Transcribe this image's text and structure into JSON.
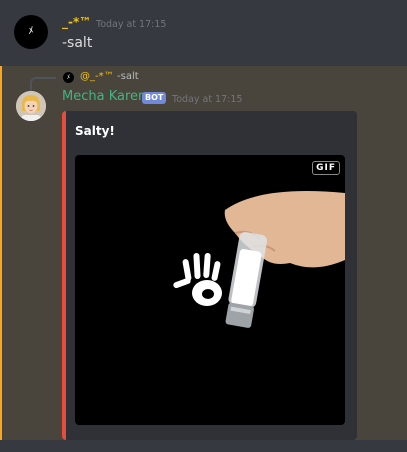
{
  "message1": {
    "author": "_-*™",
    "timestamp": "Today at 17:15",
    "content": "-salt"
  },
  "message2": {
    "reply": {
      "author": "@_-*™",
      "content": "-salt"
    },
    "author": "Mecha Karen",
    "badge": "BOT",
    "timestamp": "Today at 17:15",
    "embed": {
      "title": "Salty!",
      "gif_label": "GIF",
      "accent_color": "#e74c3c"
    }
  },
  "colors": {
    "mention_highlight": "#49443c",
    "mention_border": "#faa61a",
    "bot_username": "#43b581",
    "user_username": "#f1c40f",
    "bot_badge": "#7289da"
  }
}
